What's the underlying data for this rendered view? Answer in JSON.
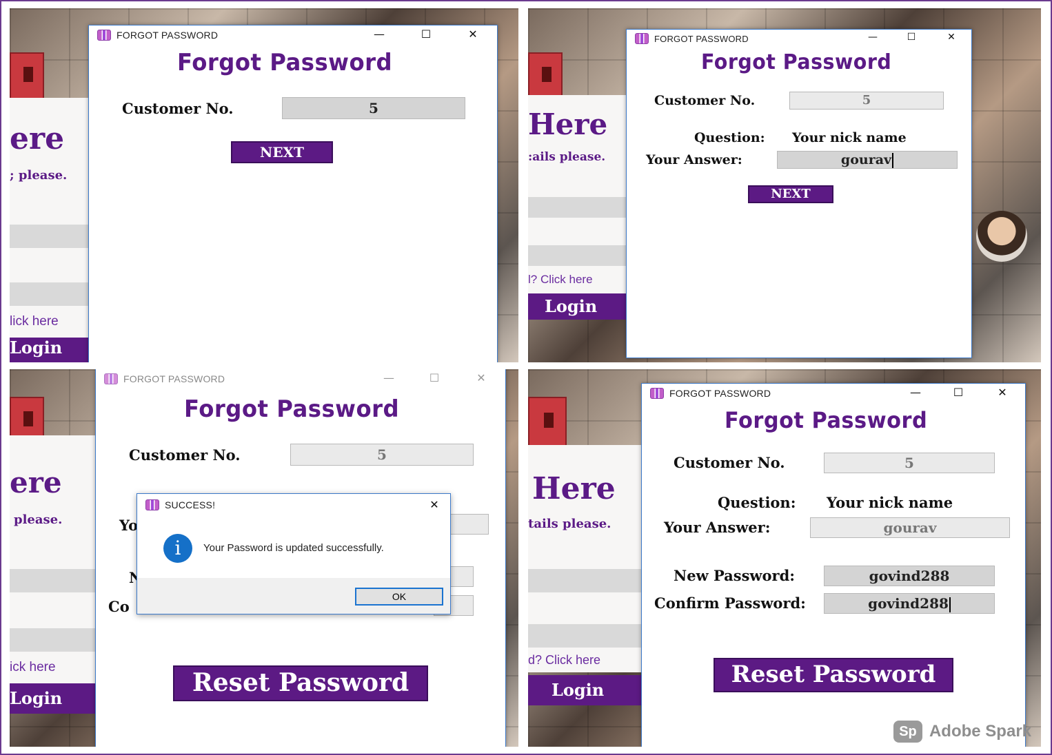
{
  "app": {
    "window_title": "FORGOT PASSWORD",
    "heading": "Forgot Password"
  },
  "labels": {
    "customer_no": "Customer No.",
    "question": "Question:",
    "answer": "Your Answer:",
    "new_password": "New Password:",
    "confirm_password": "Confirm Password:"
  },
  "values": {
    "customer_no": "5",
    "question_text": "Your nick name",
    "answer": "gourav",
    "new_password": "govind288",
    "confirm_password": "govind288"
  },
  "buttons": {
    "next": "NEXT",
    "reset": "Reset Password",
    "ok": "OK"
  },
  "background_login": {
    "heading_1": "ere",
    "heading_2": "Here",
    "sub_1": "; please.",
    "sub_2": ":ails please.",
    "sub_3": "please.",
    "sub_4": "tails please.",
    "link_1": "lick here",
    "link_2": "l? Click here",
    "link_3": "ick here",
    "link_4": "d? Click here",
    "login_1": "Login",
    "login_2": "Login",
    "login_3": "Login",
    "login_4": "Login"
  },
  "dialog": {
    "title": "SUCCESS!",
    "message": "Your Password is updated successfully.",
    "partial_1": "Yo",
    "partial_2": "N",
    "partial_3": "Co"
  },
  "watermark": {
    "logo": "Sp",
    "text": "Adobe Spark"
  },
  "colors": {
    "brand_purple": "#5b1a86",
    "button_purple": "#5c1a84",
    "window_border": "#3a78c9",
    "info_blue": "#1570c8"
  },
  "icons": [
    "app-icon",
    "minimize-icon",
    "maximize-icon",
    "close-icon",
    "info-icon"
  ]
}
